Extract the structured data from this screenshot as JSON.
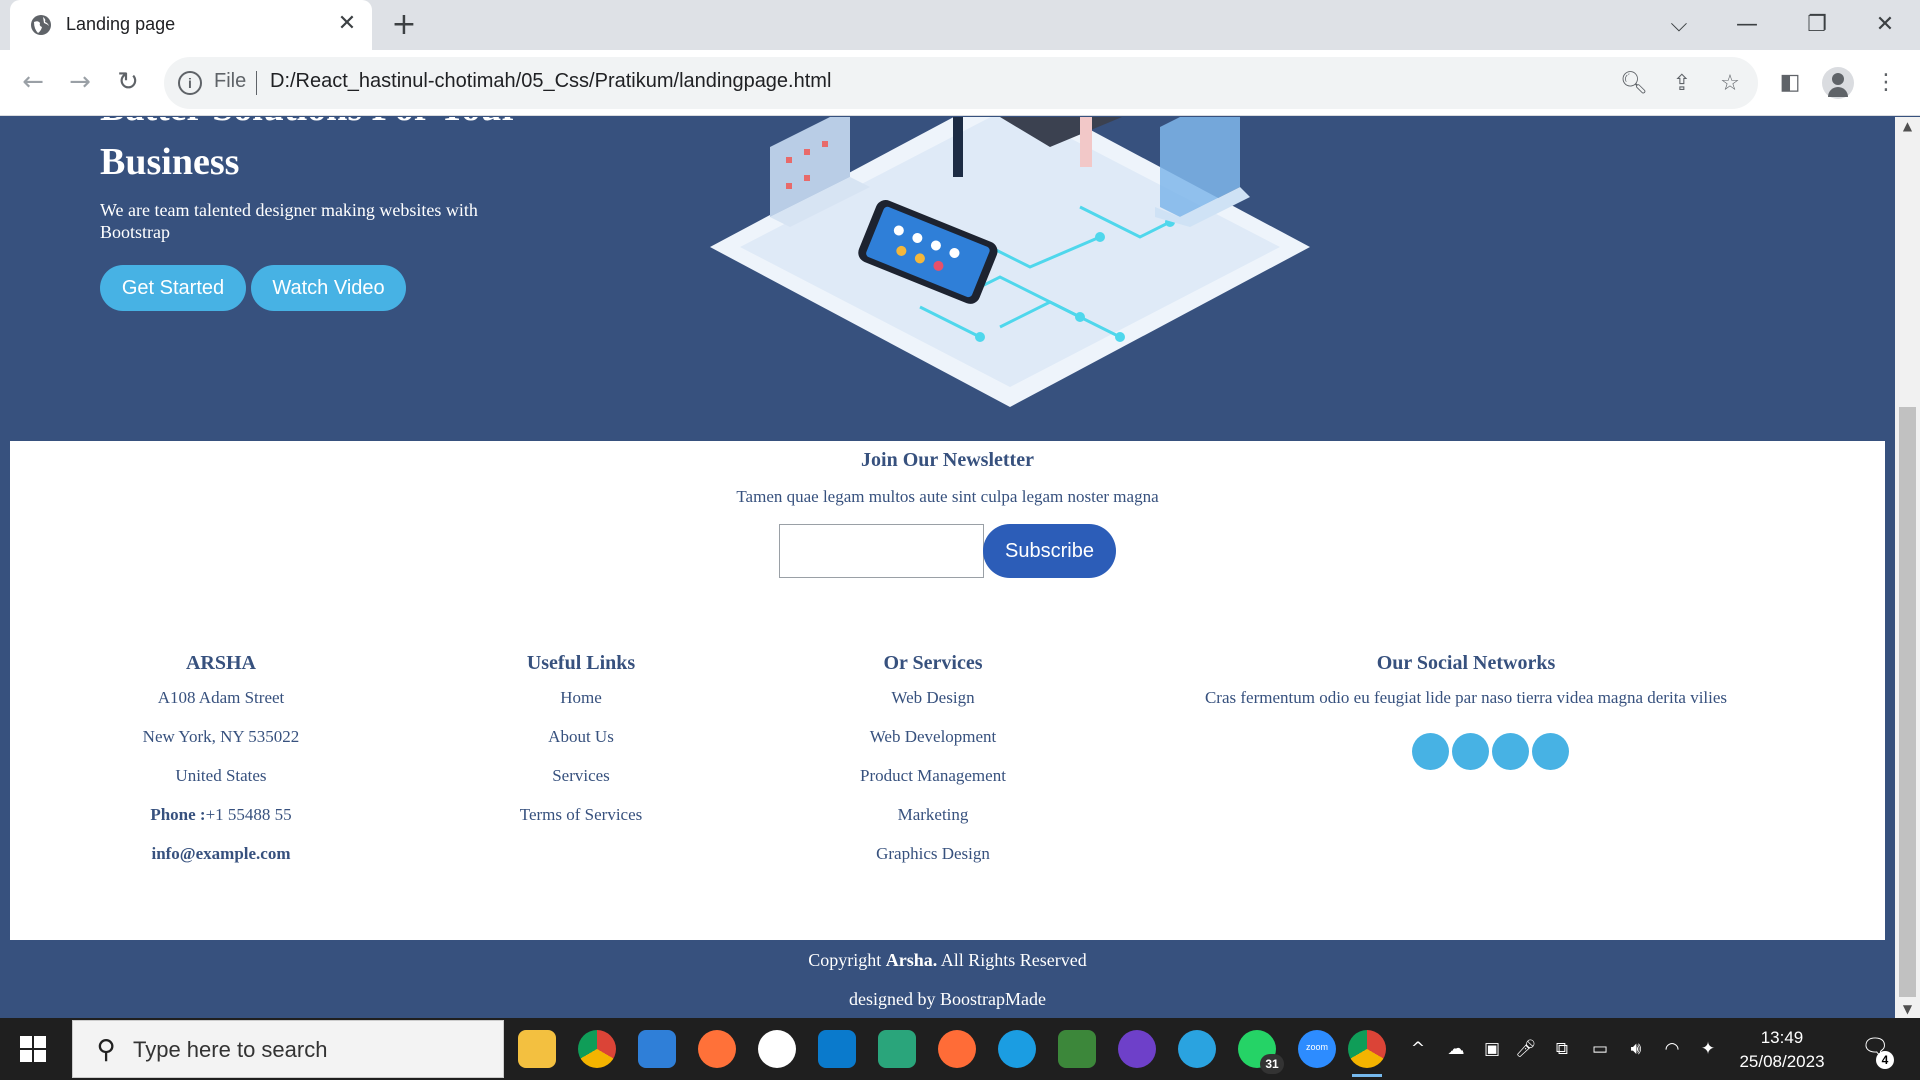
{
  "browser": {
    "tab_title": "Landing page",
    "scheme_label": "File",
    "url": "D:/React_hastinul-chotimah/05_Css/Pratikum/landingpage.html"
  },
  "hero": {
    "title": "Batter Solutions For Your Business",
    "subtitle": "We are team talented designer making websites with Bootstrap",
    "get_started": "Get Started",
    "watch_video": "Watch Video"
  },
  "newsletter": {
    "title": "Join Our Newsletter",
    "text": "Tamen quae legam multos aute sint culpa legam noster magna",
    "input_value": "",
    "subscribe": "Subscribe"
  },
  "footer": {
    "brand": {
      "title": "ARSHA",
      "address1": "A108 Adam Street",
      "address2": "New York, NY 535022",
      "country": "United States",
      "phone_label": "Phone :",
      "phone": "+1 55488 55",
      "email": "info@example.com"
    },
    "links": {
      "title": "Useful Links",
      "items": [
        "Home",
        "About Us",
        "Services",
        "Terms of Services"
      ]
    },
    "services": {
      "title": "Or Services",
      "items": [
        "Web Design",
        "Web Development",
        "Product Management",
        "Marketing",
        "Graphics Design"
      ]
    },
    "social": {
      "title": "Our Social Networks",
      "text": "Cras fermentum odio eu feugiat lide par naso tierra videa magna derita vilies"
    },
    "copyright_prefix": "Copyright",
    "copyright_brand": "Arsha.",
    "copyright_suffix": "All Rights Reserved",
    "designed_by": "designed by BoostrapMade"
  },
  "taskbar": {
    "search_placeholder": "Type here to search",
    "whatsapp_badge": "31",
    "zoom_label": "zoom",
    "time": "13:49",
    "date": "25/08/2023",
    "notifications": "4"
  },
  "colors": {
    "hero_bg": "#37517e",
    "accent": "#47b2e4",
    "subscribe": "#2c5db8"
  }
}
